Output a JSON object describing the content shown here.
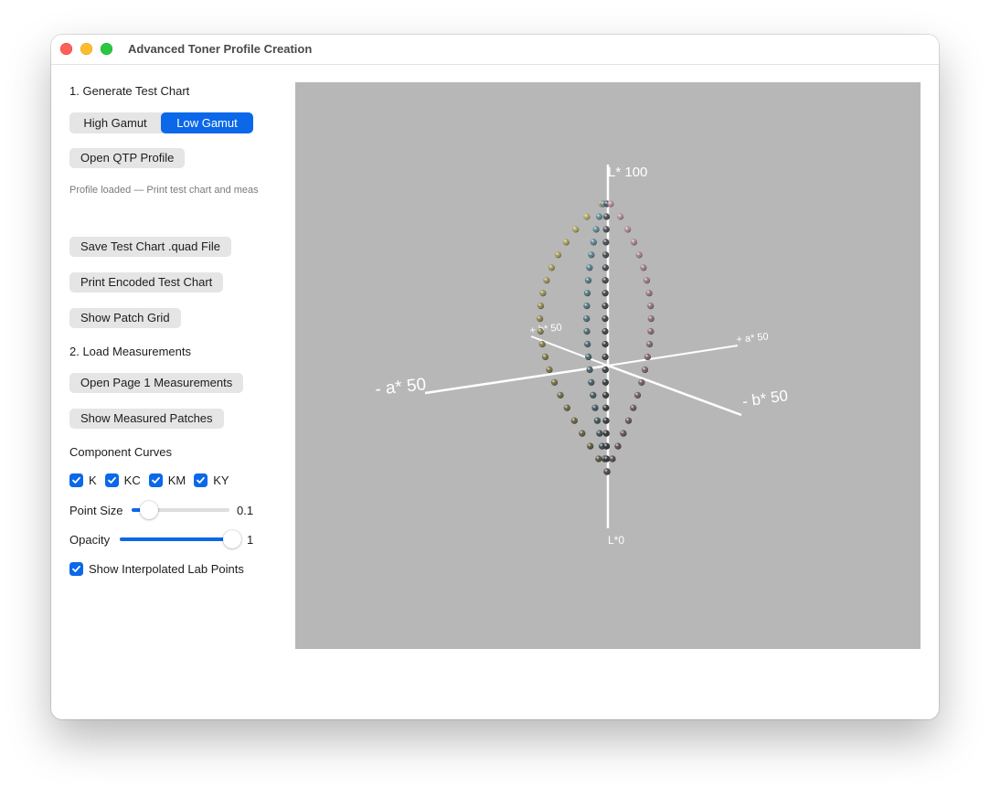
{
  "window": {
    "title": "Advanced Toner Profile Creation"
  },
  "sidebar": {
    "step1_heading": "1. Generate Test Chart",
    "gamut_toggle": {
      "options": [
        "High Gamut",
        "Low Gamut"
      ],
      "selected": "Low Gamut"
    },
    "open_qtp_label": "Open QTP Profile",
    "status_text": "Profile loaded — Print test chart and meas",
    "save_quad_label": "Save Test Chart .quad File",
    "print_chart_label": "Print Encoded Test Chart",
    "show_grid_label": "Show Patch Grid",
    "step2_heading": "2. Load Measurements",
    "open_page1_label": "Open Page 1 Measurements",
    "show_patches_label": "Show Measured Patches",
    "component_heading": "Component Curves",
    "components": [
      {
        "label": "K",
        "checked": true
      },
      {
        "label": "KC",
        "checked": true
      },
      {
        "label": "KM",
        "checked": true
      },
      {
        "label": "KY",
        "checked": true
      }
    ],
    "point_size": {
      "label": "Point Size",
      "value": 0.1,
      "display": "0.1",
      "fraction": 0.1
    },
    "opacity": {
      "label": "Opacity",
      "value": 1,
      "display": "1",
      "fraction": 1.0
    },
    "interpolated": {
      "label": "Show Interpolated Lab Points",
      "checked": true
    }
  },
  "viewport": {
    "background": "#b7b7b7",
    "axes": {
      "l_top": "L* 100",
      "l_bottom": "L*0",
      "neg_a": "- a* 50",
      "pos_a": "+ a* 50",
      "neg_b": "- b* 50",
      "pos_b": "+ b* 50"
    }
  },
  "colors": {
    "accent": "#0a68e9",
    "control_bg": "#e5e5e5"
  }
}
